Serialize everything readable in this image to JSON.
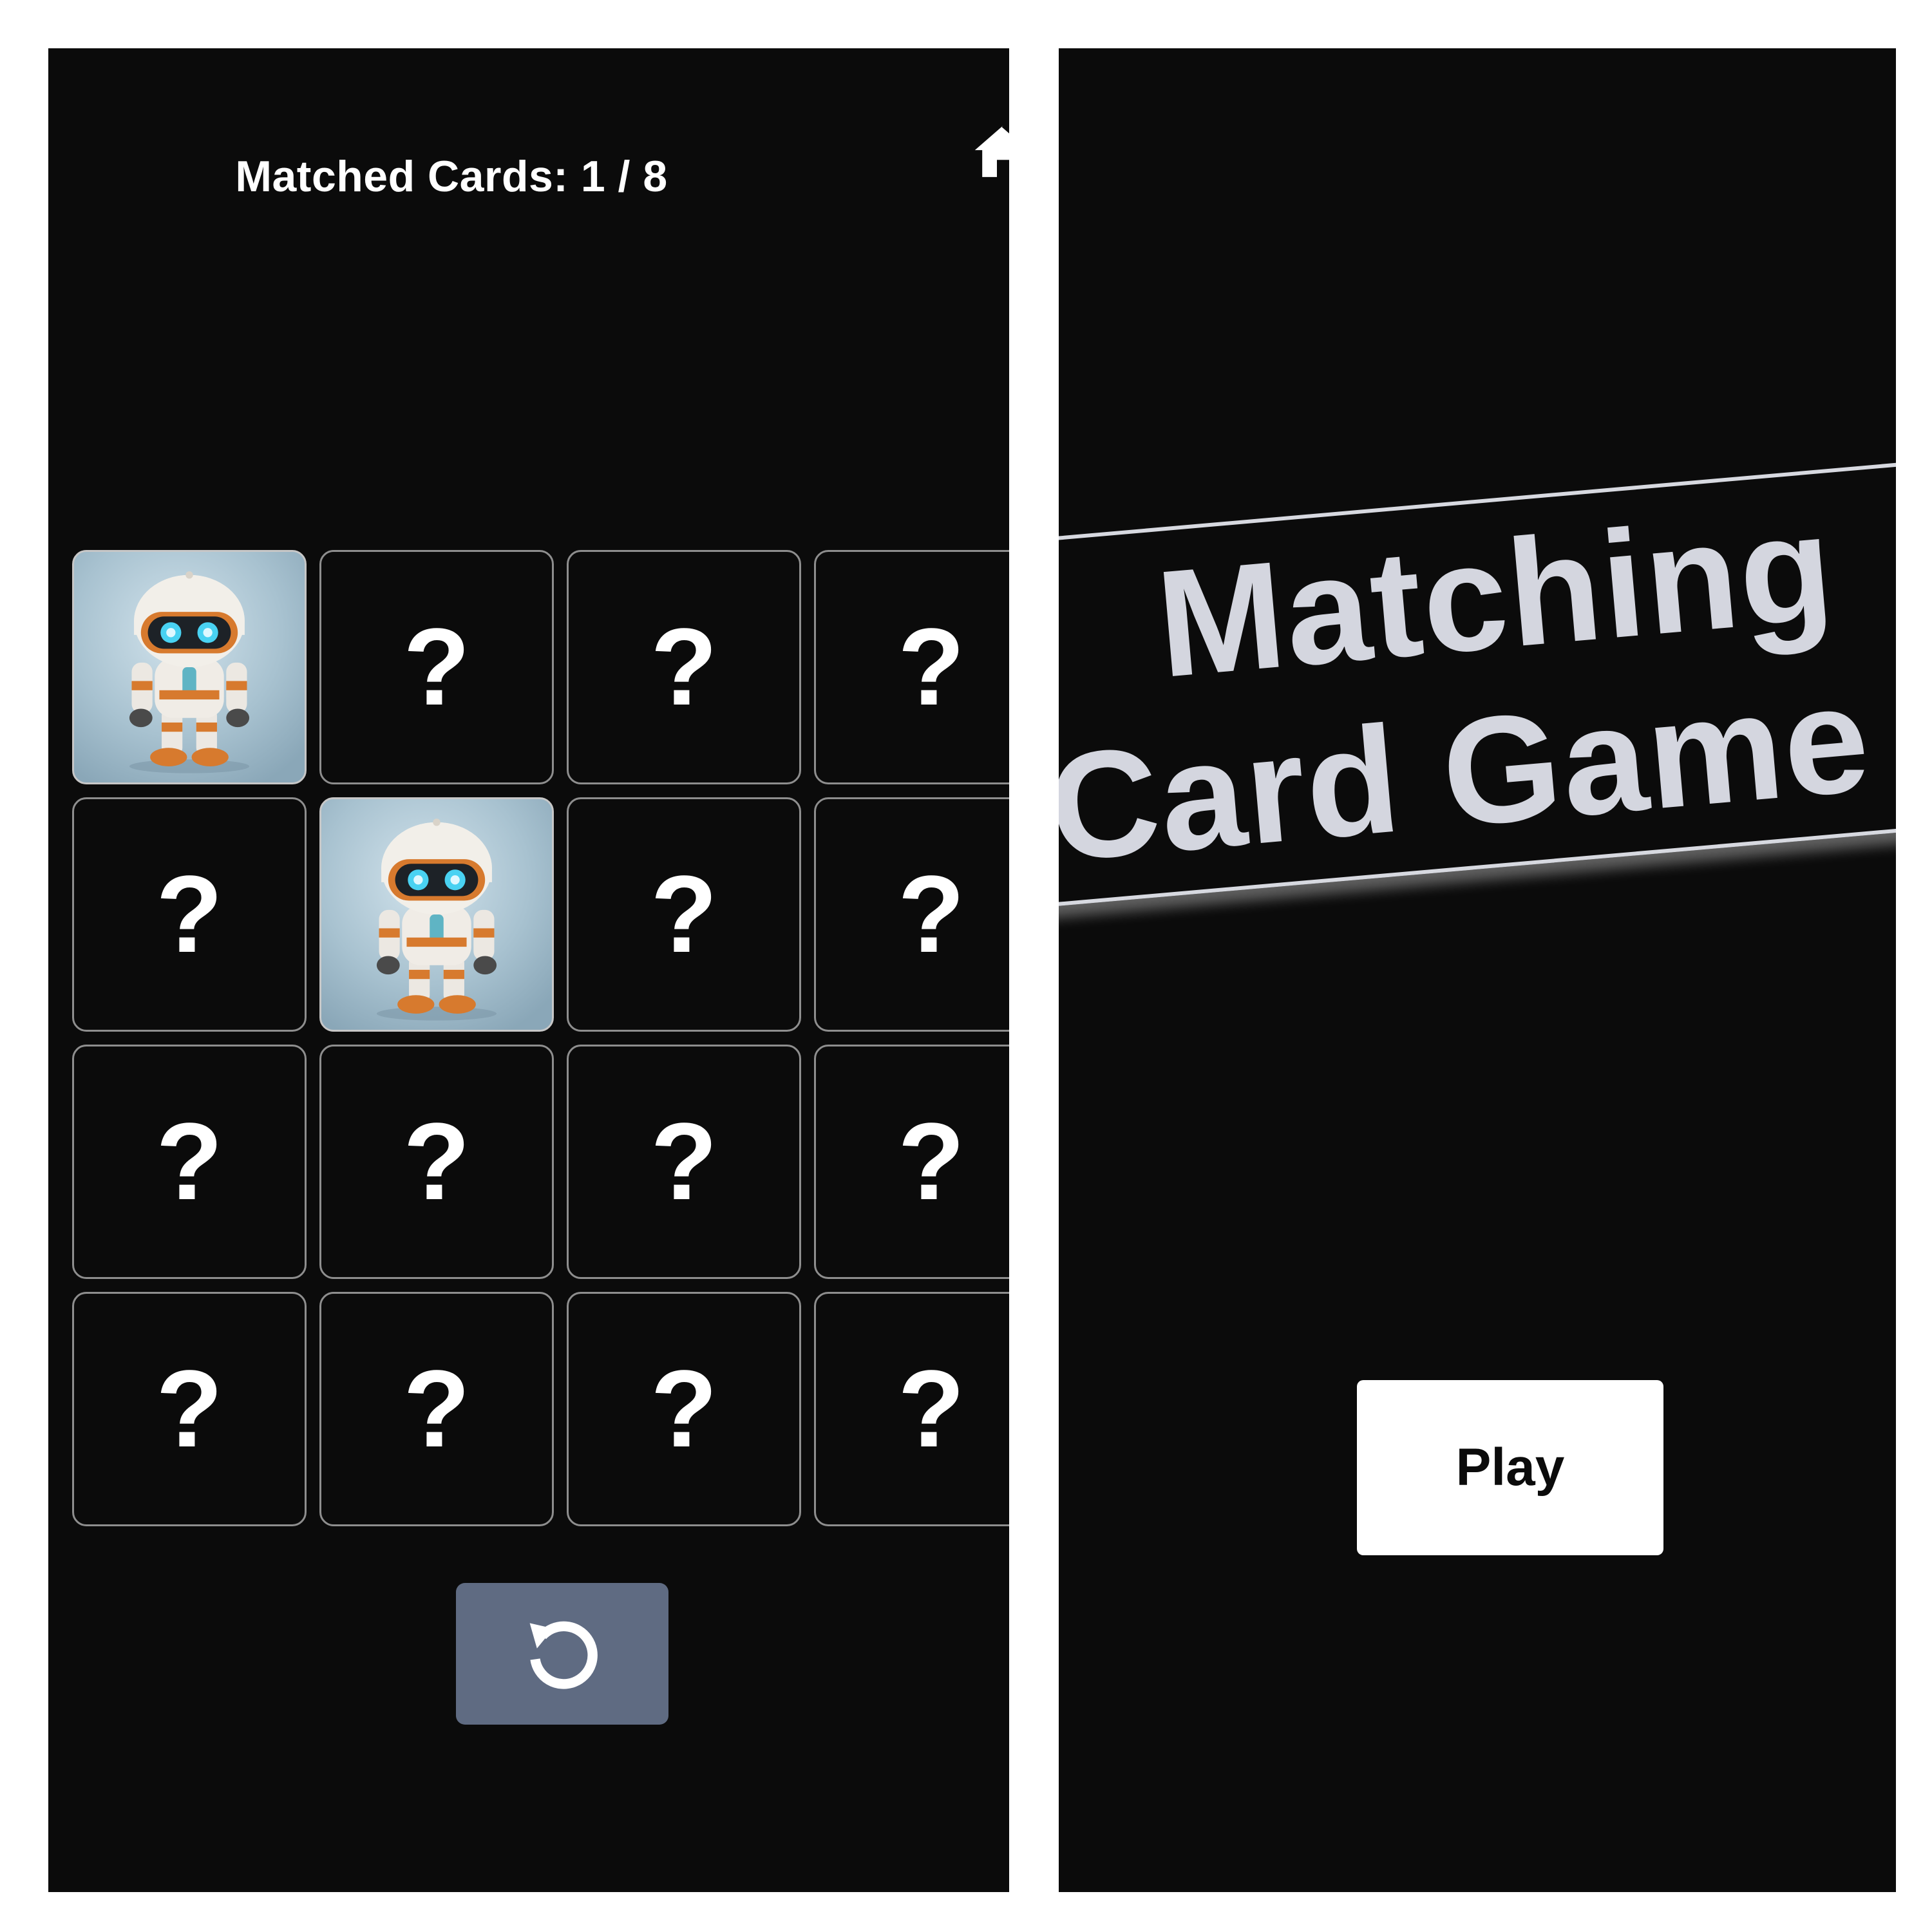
{
  "game": {
    "score_text": "Matched Cards: 1 / 8",
    "home_icon": "home-icon",
    "restart_icon": "restart-icon",
    "cards": [
      {
        "state": "flipped",
        "label": "",
        "image": "robot-image"
      },
      {
        "state": "hidden",
        "label": "?"
      },
      {
        "state": "hidden",
        "label": "?"
      },
      {
        "state": "hidden",
        "label": "?"
      },
      {
        "state": "hidden",
        "label": "?"
      },
      {
        "state": "flipped",
        "label": "",
        "image": "robot-image"
      },
      {
        "state": "hidden",
        "label": "?"
      },
      {
        "state": "hidden",
        "label": "?"
      },
      {
        "state": "hidden",
        "label": "?"
      },
      {
        "state": "hidden",
        "label": "?"
      },
      {
        "state": "hidden",
        "label": "?"
      },
      {
        "state": "hidden",
        "label": "?"
      },
      {
        "state": "hidden",
        "label": "?"
      },
      {
        "state": "hidden",
        "label": "?"
      },
      {
        "state": "hidden",
        "label": "?"
      },
      {
        "state": "hidden",
        "label": "?"
      }
    ],
    "colors": {
      "background": "#0b0b0b",
      "card_border": "#8e8e8e",
      "restart_button": "#5f6b82"
    }
  },
  "title_screen": {
    "title_line1": "Matching",
    "title_line2": "Card Game",
    "play_label": "Play",
    "colors": {
      "title_text": "#d4d6df",
      "play_button": "#ffffff"
    }
  }
}
